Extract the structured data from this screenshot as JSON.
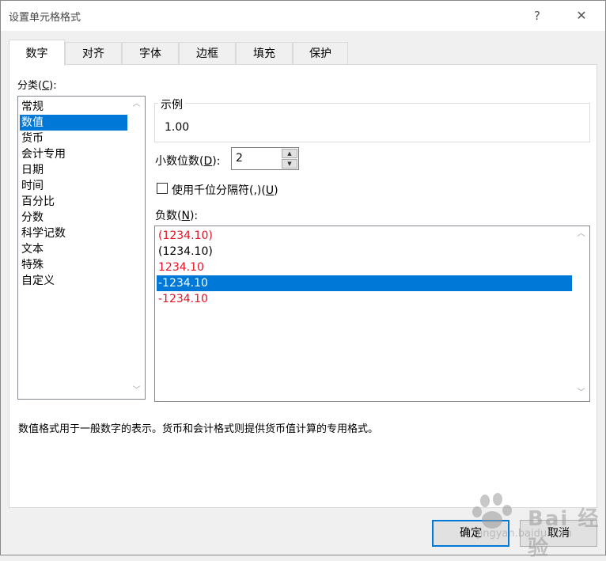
{
  "dialog": {
    "title": "设置单元格格式",
    "help_label": "?",
    "close_label": "✕"
  },
  "tabs": [
    "数字",
    "对齐",
    "字体",
    "边框",
    "填充",
    "保护"
  ],
  "category": {
    "label_prefix": "分类(",
    "label_key": "C",
    "label_suffix": "):",
    "items": [
      "常规",
      "数值",
      "货币",
      "会计专用",
      "日期",
      "时间",
      "百分比",
      "分数",
      "科学记数",
      "文本",
      "特殊",
      "自定义"
    ],
    "selected": "数值"
  },
  "sample": {
    "title": "示例",
    "value": "1.00"
  },
  "decimal": {
    "label_prefix": "小数位数(",
    "label_key": "D",
    "label_suffix": "):",
    "value": "2"
  },
  "separator": {
    "label_prefix": "使用千位分隔符(,)(",
    "label_key": "U",
    "label_suffix": ")",
    "checked": false
  },
  "negative": {
    "label_prefix": "负数(",
    "label_key": "N",
    "label_suffix": "):",
    "items": [
      {
        "text": "(1234.10)",
        "red": true
      },
      {
        "text": "(1234.10)",
        "red": false
      },
      {
        "text": "1234.10",
        "red": true
      },
      {
        "text": "-1234.10",
        "red": false
      },
      {
        "text": "-1234.10",
        "red": true
      }
    ],
    "selected_index": 3
  },
  "description": "数值格式用于一般数字的表示。货币和会计格式则提供货币值计算的专用格式。",
  "buttons": {
    "ok": "确定",
    "cancel": "取消"
  },
  "watermark": {
    "text": "Bai 经验",
    "sub": "jingyan.baidu.com"
  },
  "colors": {
    "selection": "#0078d7",
    "negative_red": "#e81123"
  }
}
